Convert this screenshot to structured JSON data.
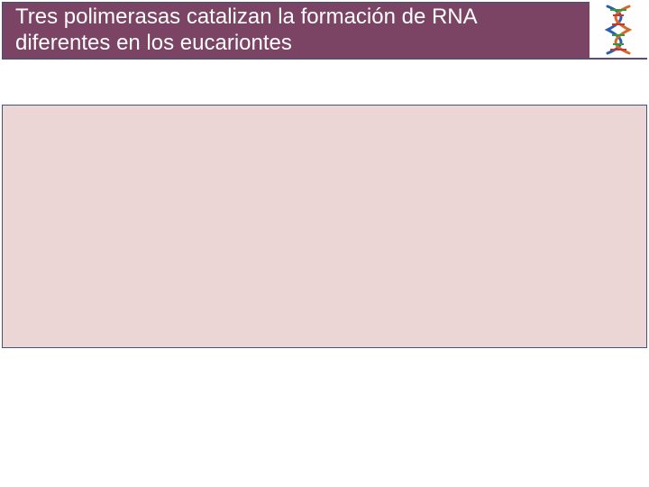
{
  "header": {
    "title_line1": "Tres polimerasas catalizan la formación de RNA",
    "title_line2": "diferentes en los eucariontes"
  },
  "icons": {
    "dna": "dna-helix-icon"
  },
  "colors": {
    "header_bg": "#7b4464",
    "frame": "#3d5678",
    "body_bg": "#ecd6d5"
  }
}
